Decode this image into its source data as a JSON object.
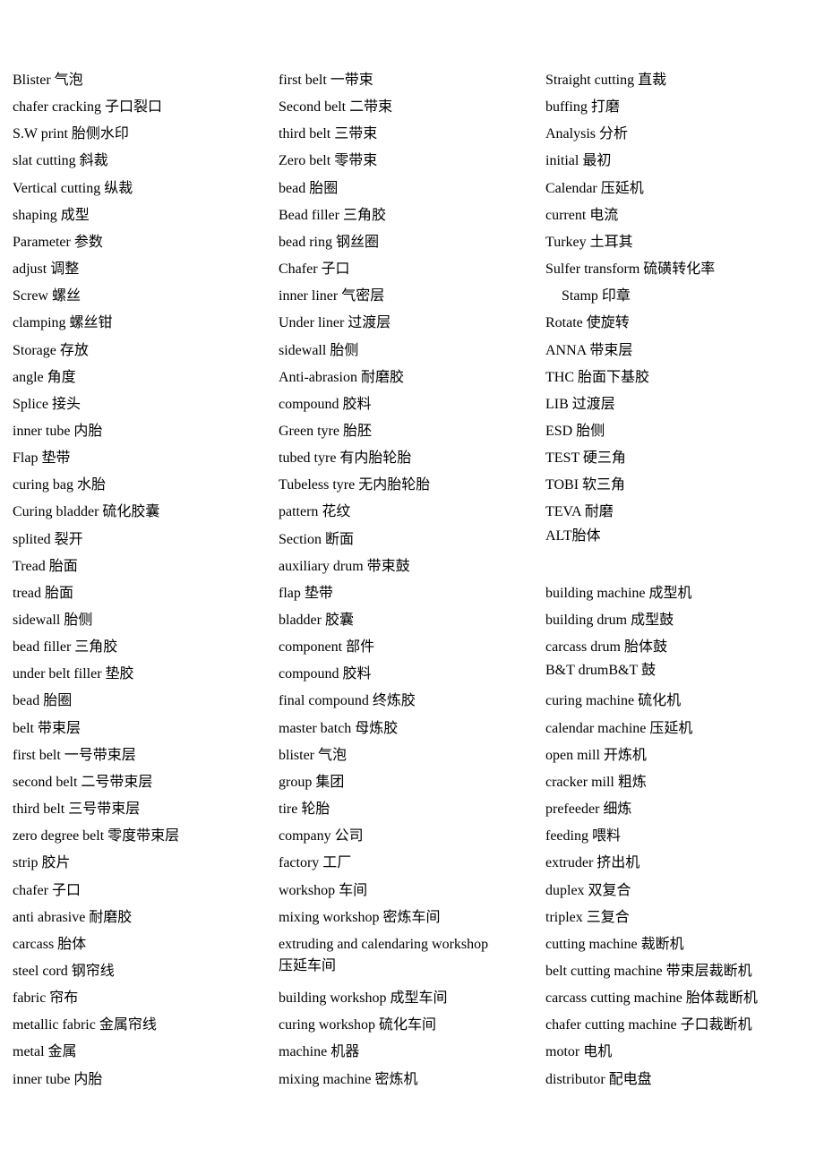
{
  "glossary": {
    "column1": [
      "Blister 气泡",
      "chafer cracking 子口裂口",
      "S.W print 胎侧水印",
      "slat cutting 斜裁",
      "Vertical cutting 纵裁",
      "shaping 成型",
      "Parameter 参数",
      "adjust 调整",
      "Screw 螺丝",
      "clamping 螺丝钳",
      "Storage 存放",
      "angle 角度",
      "Splice 接头",
      "inner tube 内胎",
      "Flap 垫带",
      "curing bag 水胎",
      "Curing bladder 硫化胶囊",
      "splited 裂开",
      "Tread 胎面",
      "tread 胎面",
      "sidewall 胎侧",
      "bead filler 三角胶",
      "under belt filler 垫胶",
      "bead 胎圈",
      "belt 带束层",
      "first belt 一号带束层",
      "second belt 二号带束层",
      "third belt 三号带束层",
      "zero degree belt 零度带束层",
      "strip 胶片",
      "chafer 子口",
      "anti abrasive 耐磨胶",
      "carcass 胎体",
      "steel cord 钢帘线",
      "fabric 帘布",
      "metallic fabric 金属帘线",
      "metal 金属",
      "inner tube 内胎"
    ],
    "column2": [
      "first belt 一带束",
      "Second belt 二带束",
      "third belt 三带束",
      "Zero belt 零带束",
      "bead 胎圈",
      "Bead filler 三角胶",
      "bead ring 钢丝圈",
      "Chafer 子口",
      "inner liner 气密层",
      "Under liner 过渡层",
      "sidewall 胎侧",
      "Anti-abrasion 耐磨胶",
      "compound 胶料",
      "Green tyre 胎胚",
      "tubed tyre 有内胎轮胎",
      "Tubeless tyre 无内胎轮胎",
      "pattern 花纹",
      "Section 断面",
      "auxiliary drum 带束鼓",
      "flap 垫带",
      "bladder 胶囊",
      "component 部件",
      "compound 胶料",
      "final compound 终炼胶",
      "master batch 母炼胶",
      "blister 气泡",
      "group 集团",
      "tire 轮胎",
      "company 公司",
      "factory 工厂",
      "workshop 车间",
      "mixing workshop 密炼车间",
      "extruding and calendaring workshop 压延车间",
      "building workshop 成型车间",
      "curing workshop 硫化车间",
      "machine 机器",
      "mixing machine 密炼机"
    ],
    "column3": [
      "Straight cutting 直裁",
      "buffing 打磨",
      "Analysis 分析",
      "initial 最初",
      "Calendar 压延机",
      "current 电流",
      "Turkey 土耳其",
      "Sulfer transform 硫磺转化率",
      "Stamp 印章",
      "Rotate 使旋转",
      "ANNA 带束层",
      "THC 胎面下基胶",
      "LIB 过渡层",
      "ESD 胎侧",
      "TEST 硬三角",
      "TOBI 软三角",
      "TEVA 耐磨",
      "ALT胎体",
      "",
      "building machine 成型机",
      "building drum 成型鼓",
      "carcass drum 胎体鼓",
      "B&T drumB&T 鼓",
      "curing machine 硫化机",
      "calendar machine 压延机",
      "open mill 开炼机",
      "cracker mill 粗炼",
      "prefeeder 细炼",
      "feeding 喂料",
      "extruder 挤出机",
      "duplex 双复合",
      "triplex 三复合",
      "cutting machine 裁断机",
      "belt cutting machine 带束层裁断机",
      "carcass cutting machine 胎体裁断机",
      "chafer cutting machine 子口裁断机",
      "motor 电机",
      "distributor 配电盘"
    ]
  }
}
